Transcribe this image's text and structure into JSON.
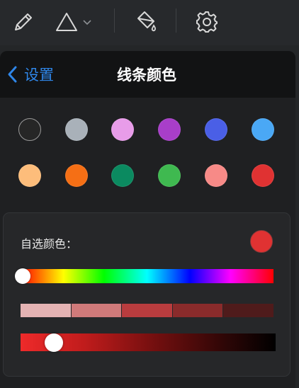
{
  "toolbar": {
    "icons": [
      "pencil-icon",
      "triangle-icon",
      "chevron-down-icon",
      "paint-bucket-icon",
      "gear-icon"
    ]
  },
  "panel": {
    "back_label": "设置",
    "title": "线条颜色"
  },
  "palette": {
    "row1": [
      "#262626",
      "#a9b1b9",
      "#e89ce9",
      "#a83ec9",
      "#4a5fe6",
      "#4aa8f5"
    ],
    "row2": [
      "#fdbd7b",
      "#f56f15",
      "#0b8a60",
      "#3fb950",
      "#f78a87",
      "#e03232"
    ]
  },
  "custom": {
    "label": "自选颜色：",
    "current_color": "#e03232",
    "hue_position_fraction": 0.0,
    "shades": [
      "#e4b3b3",
      "#d07a7a",
      "#b93c3e",
      "#8a2b2b",
      "#4f1b1b"
    ],
    "lightness_position_fraction": 0.13
  },
  "colors": {
    "accent": "#2f86e8",
    "panel_bg": "#1f2022",
    "header_bg": "#121314"
  }
}
